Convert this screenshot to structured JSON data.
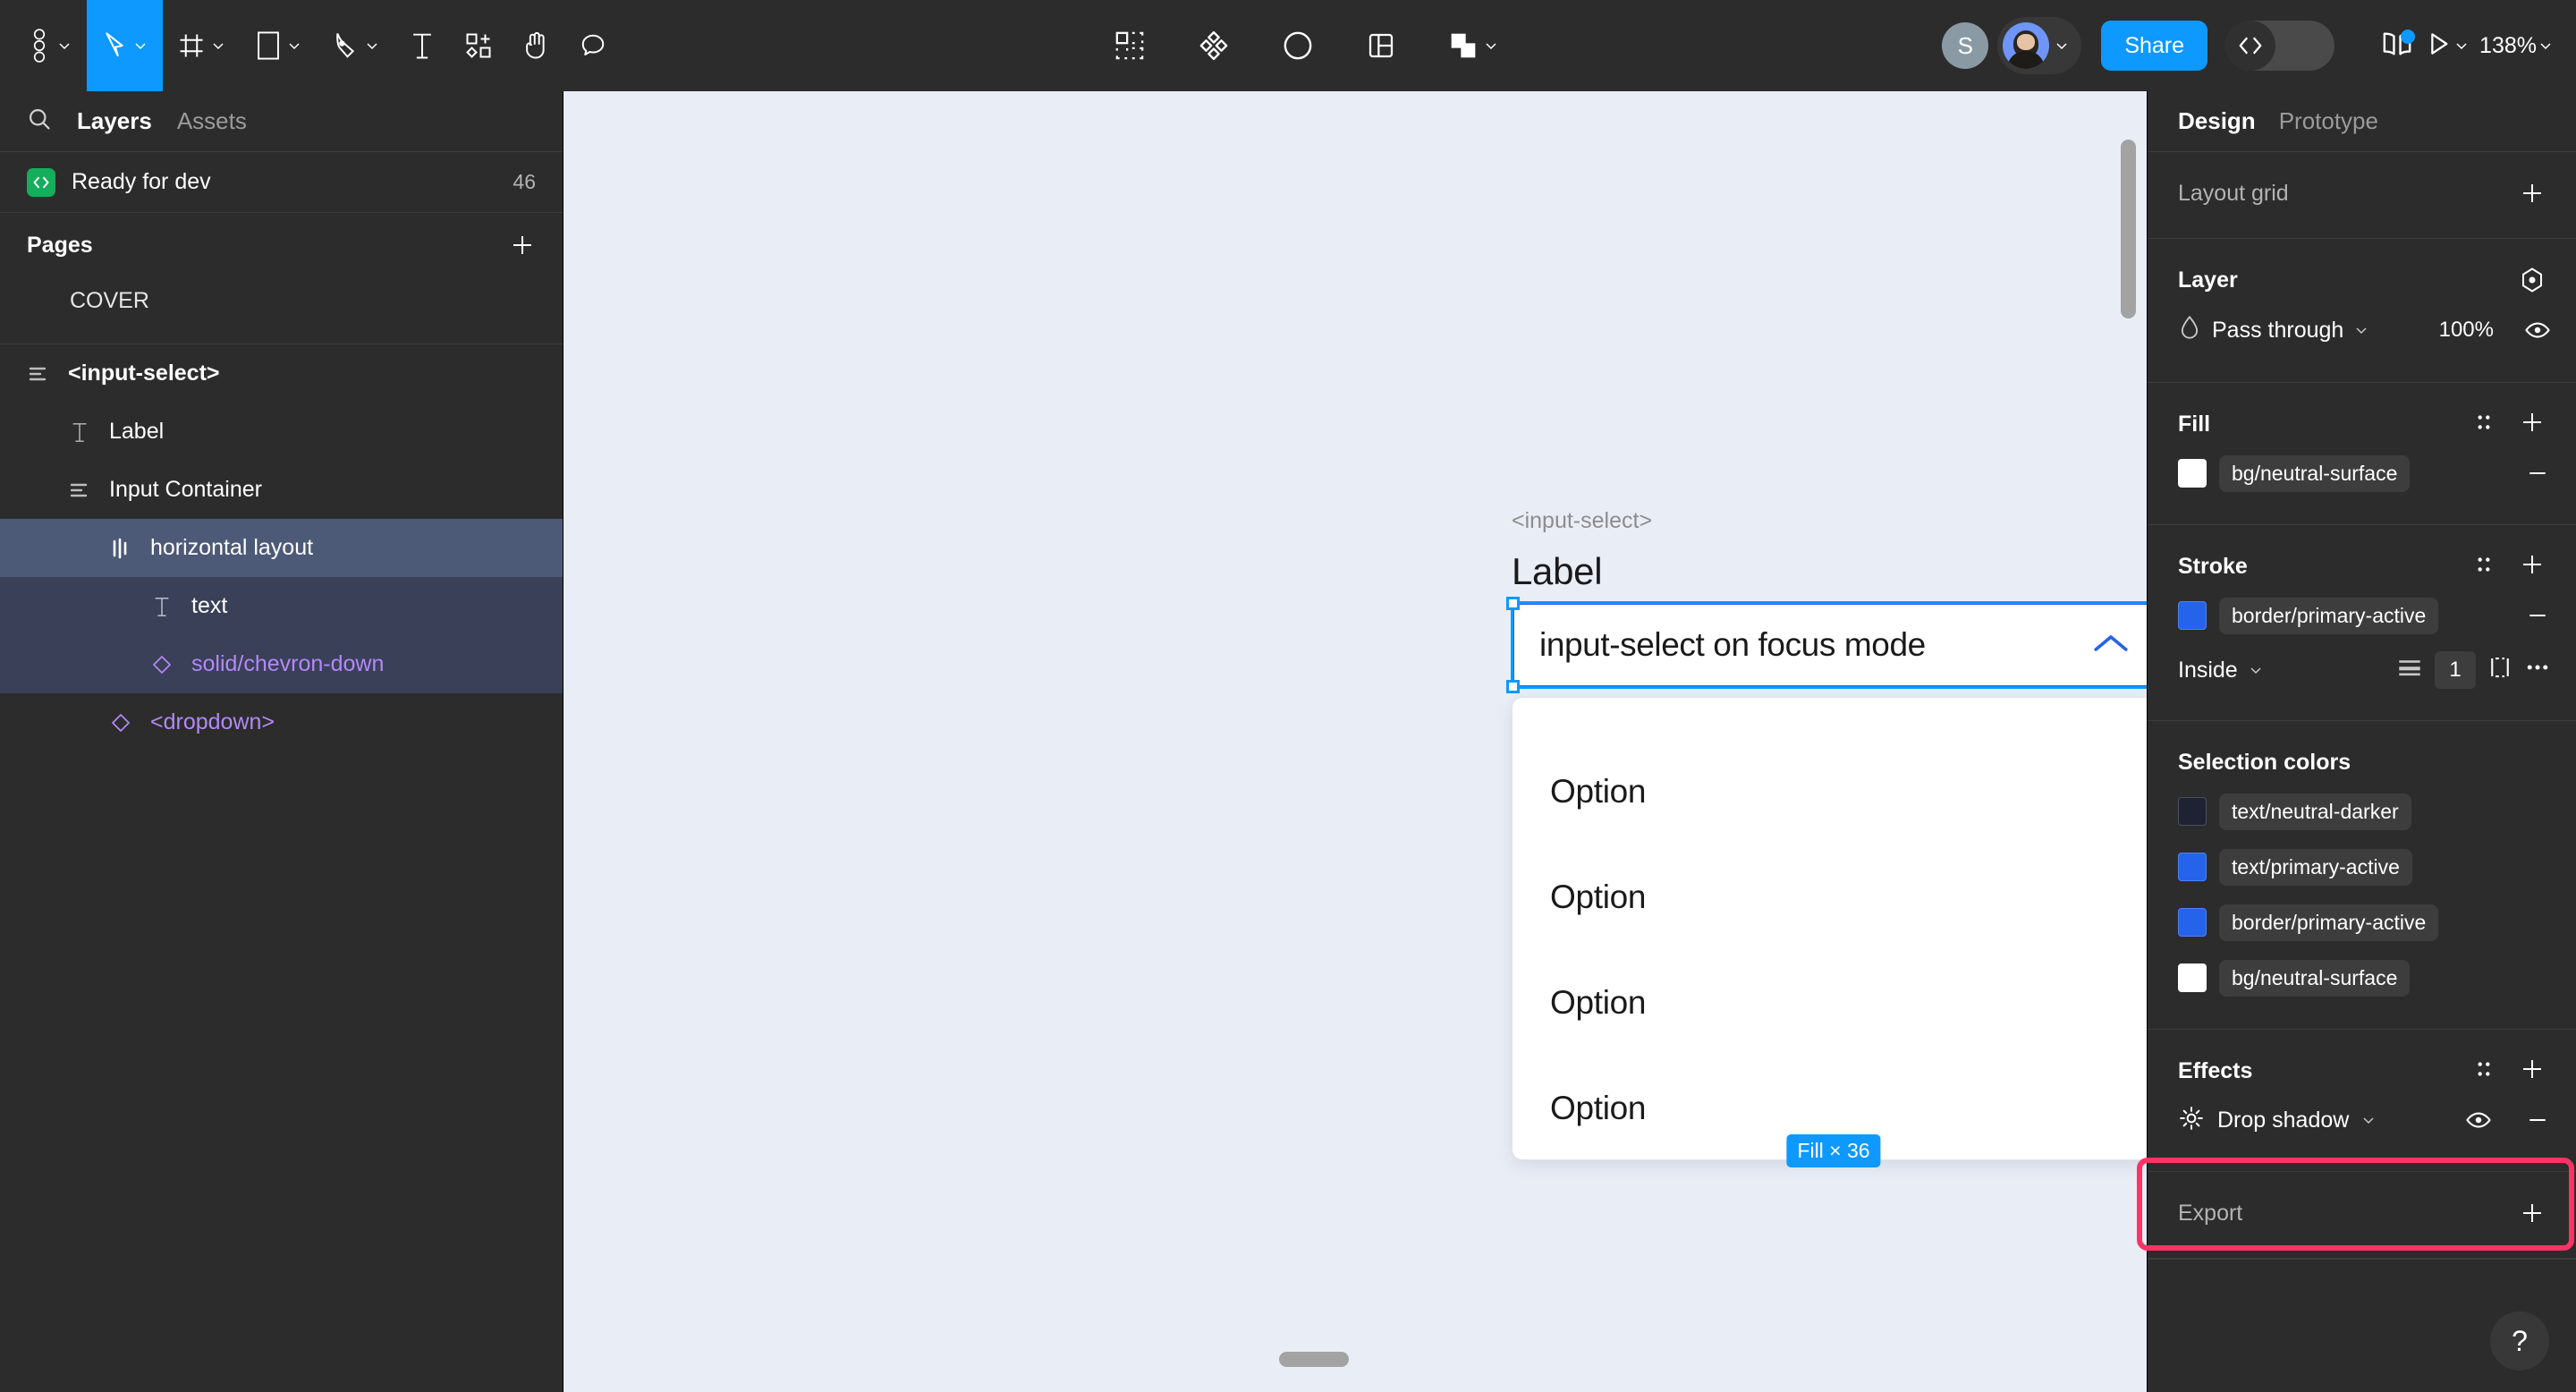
{
  "toolbar": {
    "left_tools": [
      {
        "name": "figma-logo",
        "icon": "figma-logo-icon",
        "has_chevron": true,
        "active": false
      },
      {
        "name": "move-tool",
        "icon": "cursor-arrow-icon",
        "has_chevron": true,
        "active": true
      },
      {
        "name": "frame-tool",
        "icon": "frame-icon",
        "has_chevron": true,
        "active": false
      },
      {
        "name": "shape-tool",
        "icon": "rectangle-icon",
        "has_chevron": true,
        "active": false
      },
      {
        "name": "pen-tool",
        "icon": "pen-icon",
        "has_chevron": true,
        "active": false
      },
      {
        "name": "text-tool",
        "icon": "text-icon",
        "has_chevron": false,
        "active": false
      },
      {
        "name": "resources-tool",
        "icon": "components-plus-icon",
        "has_chevron": false,
        "active": false
      },
      {
        "name": "hand-tool",
        "icon": "hand-icon",
        "has_chevron": false,
        "active": false
      },
      {
        "name": "comment-tool",
        "icon": "comment-bubble-icon",
        "has_chevron": false,
        "active": false
      }
    ],
    "center_tools": [
      {
        "name": "slice-tool",
        "icon": "slice-select-icon",
        "has_chevron": false
      },
      {
        "name": "components-tool",
        "icon": "diamonds-icon",
        "has_chevron": false
      },
      {
        "name": "mask-tool",
        "icon": "contrast-circle-icon",
        "has_chevron": false
      },
      {
        "name": "grid-layout-tool",
        "icon": "panel-layout-icon",
        "has_chevron": false
      },
      {
        "name": "boolean-tool",
        "icon": "union-shapes-icon",
        "has_chevron": true
      }
    ],
    "avatar_initial": "S",
    "share_label": "Share",
    "dev_mode_icon": "code-brackets-icon",
    "book_icon": "open-book-icon",
    "present_icon": "play-triangle-icon",
    "zoom_level": "138%"
  },
  "left_panel": {
    "search_icon": "search-icon",
    "tabs": [
      {
        "label": "Layers",
        "active": true
      },
      {
        "label": "Assets",
        "active": false
      }
    ],
    "ready_for_dev": {
      "icon": "code-brackets-icon",
      "label": "Ready for dev",
      "count": "46"
    },
    "pages": {
      "title": "Pages",
      "add_icon": "plus-icon",
      "items": [
        {
          "label": "COVER"
        }
      ]
    },
    "layers": [
      {
        "label": "<input-select>",
        "icon": "autolayout-vertical-icon",
        "indent": 0,
        "bold": true,
        "purple": false,
        "state": "none"
      },
      {
        "label": "Label",
        "icon": "text-icon",
        "indent": 1,
        "bold": false,
        "purple": false,
        "state": "none"
      },
      {
        "label": "Input Container",
        "icon": "autolayout-vertical-icon",
        "indent": 1,
        "bold": false,
        "purple": false,
        "state": "none"
      },
      {
        "label": "horizontal layout",
        "icon": "autolayout-horizontal-icon",
        "indent": 2,
        "bold": false,
        "purple": false,
        "state": "selected-parent"
      },
      {
        "label": "text",
        "icon": "text-icon",
        "indent": 3,
        "bold": false,
        "purple": false,
        "state": "selected-child"
      },
      {
        "label": "solid/chevron-down",
        "icon": "component-diamond-icon",
        "indent": 3,
        "bold": false,
        "purple": true,
        "state": "selected-child"
      },
      {
        "label": "<dropdown>",
        "icon": "component-diamond-icon",
        "indent": 2,
        "bold": false,
        "purple": true,
        "state": "none"
      }
    ]
  },
  "canvas": {
    "frame_tag": "<input-select>",
    "field_label": "Label",
    "select_value": "input-select on focus mode",
    "chevron_icon": "chevron-up-icon",
    "fill_badge": "Fill × 36",
    "dropdown_options": [
      "Option",
      "Option",
      "Option",
      "Option"
    ]
  },
  "right_panel": {
    "tabs": [
      {
        "label": "Design",
        "active": true
      },
      {
        "label": "Prototype",
        "active": false
      }
    ],
    "layout_grid": {
      "title": "Layout grid",
      "add_icon": "plus-icon"
    },
    "layer": {
      "title": "Layer",
      "settings_icon": "layer-settings-icon",
      "blend_icon": "blend-drop-icon",
      "blend_mode": "Pass through",
      "opacity": "100%",
      "visibility_icon": "eye-icon"
    },
    "fill": {
      "title": "Fill",
      "style_icon": "style-dots-icon",
      "add_icon": "plus-icon",
      "items": [
        {
          "token": "bg/neutral-surface",
          "color": "#ffffff",
          "remove_icon": "minus-icon"
        }
      ]
    },
    "stroke": {
      "title": "Stroke",
      "style_icon": "style-dots-icon",
      "add_icon": "plus-icon",
      "items": [
        {
          "token": "border/primary-active",
          "color": "#2563eb",
          "remove_icon": "minus-icon"
        }
      ],
      "position": "Inside",
      "align_icon": "stroke-align-icon",
      "weight": "1",
      "advanced_icon": "stroke-sides-icon",
      "more_icon": "more-dots-icon"
    },
    "selection_colors": {
      "title": "Selection colors",
      "items": [
        {
          "token": "text/neutral-darker",
          "color": "#1e2233"
        },
        {
          "token": "text/primary-active",
          "color": "#2563eb"
        },
        {
          "token": "border/primary-active",
          "color": "#2563eb"
        },
        {
          "token": "bg/neutral-surface",
          "color": "#ffffff"
        }
      ]
    },
    "effects": {
      "title": "Effects",
      "style_icon": "style-dots-icon",
      "add_icon": "plus-icon",
      "highlight_color": "#ff3366",
      "items": [
        {
          "icon": "sun-effect-icon",
          "label": "Drop shadow",
          "visibility_icon": "eye-icon",
          "remove_icon": "minus-icon"
        }
      ]
    },
    "export": {
      "title": "Export",
      "add_icon": "plus-icon"
    },
    "help_label": "?"
  }
}
